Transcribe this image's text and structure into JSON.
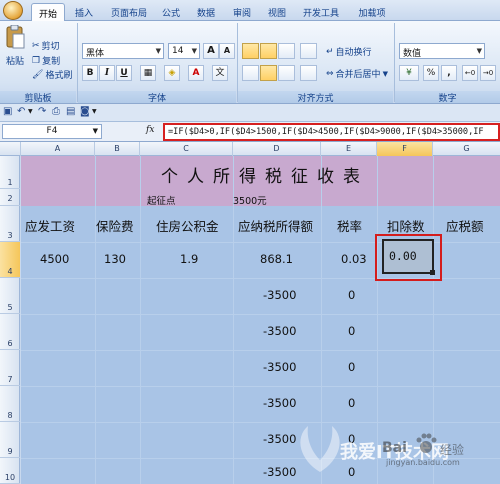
{
  "ribbon": {
    "tabs": [
      "开始",
      "插入",
      "页面布局",
      "公式",
      "数据",
      "审阅",
      "视图",
      "开发工具",
      "加载项"
    ],
    "active_tab": "开始",
    "clipboard": {
      "paste": "粘贴",
      "cut": "剪切",
      "copy": "复制",
      "format_painter": "格式刷",
      "label": "剪贴板"
    },
    "font": {
      "name": "黑体",
      "size": "14",
      "bold": "B",
      "italic": "I",
      "underline": "U",
      "grow": "A",
      "shrink": "A",
      "label": "字体"
    },
    "alignment": {
      "wrap_text": "自动换行",
      "merge_center": "合并后居中",
      "label": "对齐方式"
    },
    "number": {
      "format": "数值",
      "percent": "%",
      "comma": ",",
      "label": "数字"
    }
  },
  "formula_bar": {
    "name_box": "F4",
    "fx": "fx",
    "formula": "=IF($D4>0,IF($D4>1500,IF($D4>4500,IF($D4>9000,IF($D4>35000,IF"
  },
  "grid": {
    "columns": [
      "A",
      "B",
      "C",
      "D",
      "E",
      "F",
      "G"
    ],
    "rows": [
      "1",
      "2",
      "3",
      "4",
      "5",
      "6",
      "7",
      "8",
      "9",
      "10"
    ],
    "selected_column": "F",
    "selected_row": "4"
  },
  "sheet": {
    "title": "个人所得税征收表",
    "start_label": "起征点",
    "start_value": "3500元",
    "headers": [
      "应发工资",
      "保险费",
      "住房公积金",
      "应纳税所得额",
      "税率",
      "扣除数",
      "应税额"
    ],
    "row4": {
      "salary": "4500",
      "insurance": "130",
      "housing": "1.9",
      "taxable": "868.1",
      "rate": "0.03",
      "deduction": "0.00"
    },
    "d_values": [
      "-3500",
      "-3500",
      "-3500",
      "-3500",
      "-3500",
      "-3500"
    ],
    "e_values": [
      "0",
      "0",
      "0",
      "0",
      "0",
      "0"
    ]
  },
  "watermark": {
    "cn": "我爱IT技术网",
    "brand": "Bai",
    "brand2": "经验",
    "url": "jingyan.baidu.com"
  }
}
